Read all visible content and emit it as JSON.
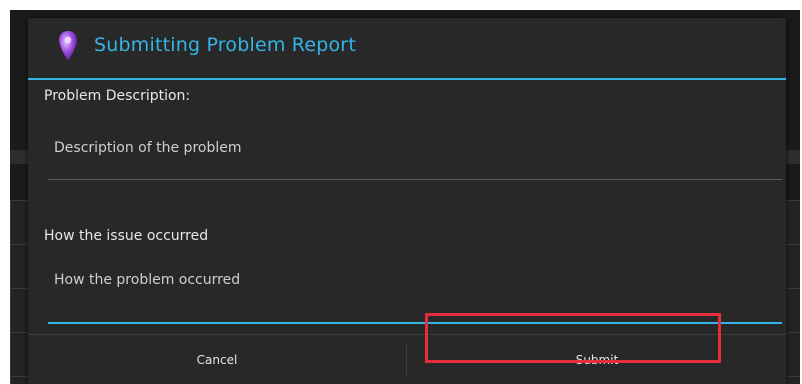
{
  "dialog": {
    "title": "Submitting Problem Report",
    "icon": "location-pin-icon",
    "accent_color": "#33b5e5"
  },
  "form": {
    "description_label": "Problem Description:",
    "description_placeholder": "Description of the problem",
    "description_value": "",
    "how_label": "How the issue occurred",
    "how_placeholder": "How the problem occurred",
    "how_value": ""
  },
  "buttons": {
    "cancel_label": "Cancel",
    "submit_label": "Submit"
  },
  "highlight": {
    "target": "submit-button",
    "color": "#e52e3c"
  }
}
